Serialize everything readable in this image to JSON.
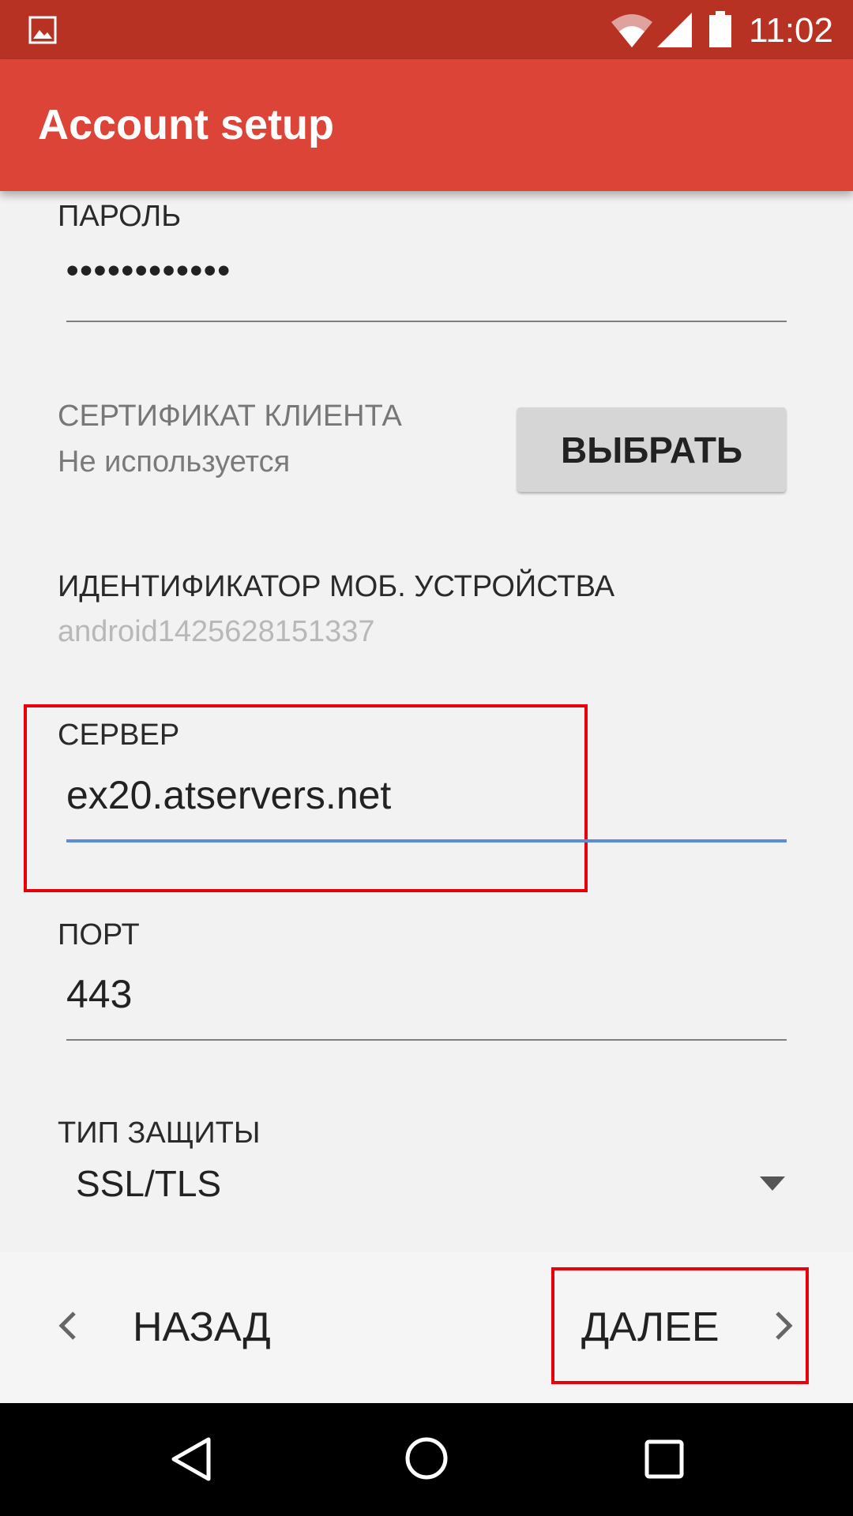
{
  "status_bar": {
    "time": "11:02",
    "icons": [
      "image-notification-icon",
      "wifi-icon",
      "cell-signal-icon",
      "battery-icon"
    ]
  },
  "app_bar": {
    "title": "Account setup"
  },
  "form": {
    "password": {
      "label": "ПАРОЛЬ",
      "value": "••••••••••••"
    },
    "client_certificate": {
      "label": "СЕРТИФИКАТ КЛИЕНТА",
      "status": "Не используется",
      "button_label": "ВЫБРАТЬ"
    },
    "device_id": {
      "label": "ИДЕНТИФИКАТОР МОБ. УСТРОЙСТВА",
      "value": "android1425628151337"
    },
    "server": {
      "label": "СЕРВЕР",
      "value": "ex20.atservers.net"
    },
    "port": {
      "label": "ПОРТ",
      "value": "443"
    },
    "security_type": {
      "label": "ТИП ЗАЩИТЫ",
      "selected": "SSL/TLS"
    }
  },
  "footer": {
    "back_label": "НАЗАД",
    "next_label": "ДАЛЕЕ"
  },
  "colors": {
    "status_bar": "#b83224",
    "app_bar": "#db4437",
    "highlight": "#e8000b",
    "focused_underline": "#5e8cd6"
  }
}
